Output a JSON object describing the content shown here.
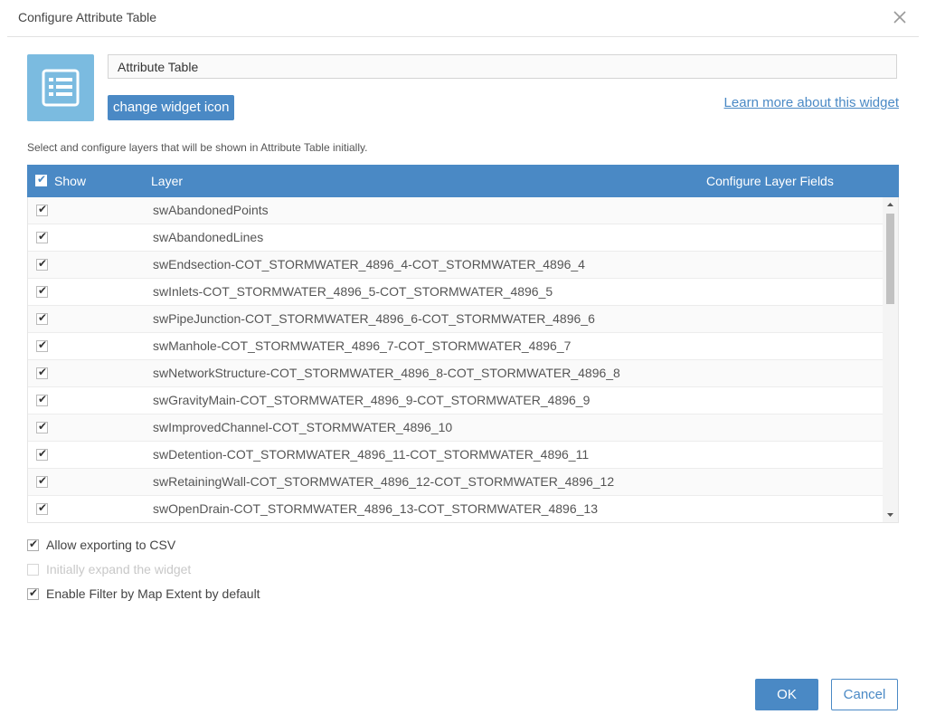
{
  "window": {
    "title": "Configure Attribute Table",
    "close_icon": "close-icon"
  },
  "header": {
    "widget_icon": "table-list-icon",
    "name_value": "Attribute Table",
    "change_icon_label": "change widget icon",
    "learn_more_label": "Learn more about this widget"
  },
  "description": "Select and configure layers that will be shown in Attribute Table initially.",
  "table": {
    "columns": [
      "Show",
      "Layer",
      "Configure Layer Fields"
    ],
    "header_checked": true,
    "rows": [
      {
        "checked": true,
        "layer": "swAbandonedPoints"
      },
      {
        "checked": true,
        "layer": "swAbandonedLines"
      },
      {
        "checked": true,
        "layer": "swEndsection-COT_STORMWATER_4896_4-COT_STORMWATER_4896_4"
      },
      {
        "checked": true,
        "layer": "swInlets-COT_STORMWATER_4896_5-COT_STORMWATER_4896_5"
      },
      {
        "checked": true,
        "layer": "swPipeJunction-COT_STORMWATER_4896_6-COT_STORMWATER_4896_6"
      },
      {
        "checked": true,
        "layer": "swManhole-COT_STORMWATER_4896_7-COT_STORMWATER_4896_7"
      },
      {
        "checked": true,
        "layer": "swNetworkStructure-COT_STORMWATER_4896_8-COT_STORMWATER_4896_8"
      },
      {
        "checked": true,
        "layer": "swGravityMain-COT_STORMWATER_4896_9-COT_STORMWATER_4896_9"
      },
      {
        "checked": true,
        "layer": "swImprovedChannel-COT_STORMWATER_4896_10"
      },
      {
        "checked": true,
        "layer": "swDetention-COT_STORMWATER_4896_11-COT_STORMWATER_4896_11"
      },
      {
        "checked": true,
        "layer": "swRetainingWall-COT_STORMWATER_4896_12-COT_STORMWATER_4896_12"
      },
      {
        "checked": true,
        "layer": "swOpenDrain-COT_STORMWATER_4896_13-COT_STORMWATER_4896_13"
      }
    ]
  },
  "options": [
    {
      "label": "Allow exporting to CSV",
      "checked": true,
      "disabled": false
    },
    {
      "label": "Initially expand the widget",
      "checked": false,
      "disabled": true
    },
    {
      "label": "Enable Filter by Map Extent by default",
      "checked": true,
      "disabled": false
    }
  ],
  "footer": {
    "ok_label": "OK",
    "cancel_label": "Cancel"
  },
  "colors": {
    "accent": "#4a89c5",
    "icon_bg": "#7bbbe0"
  }
}
